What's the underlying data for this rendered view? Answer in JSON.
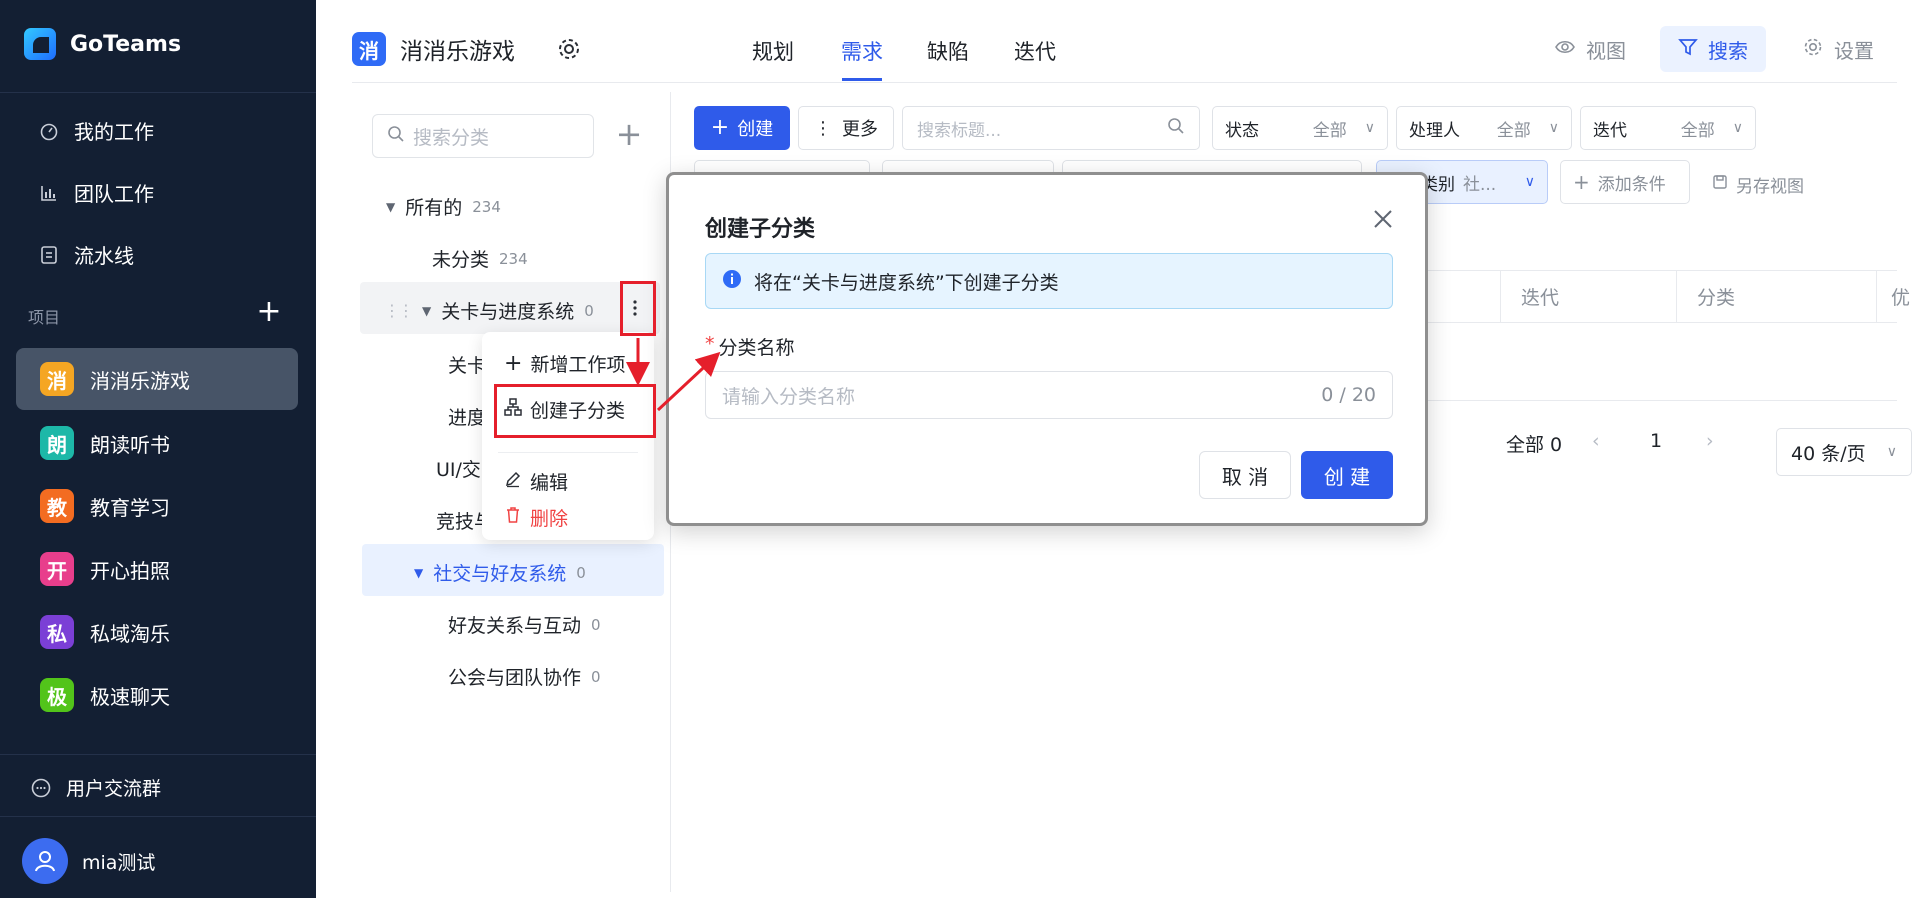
{
  "app": {
    "name": "GoTeams"
  },
  "nav": {
    "items": [
      {
        "label": "我的工作",
        "icon": "dashboard-icon"
      },
      {
        "label": "团队工作",
        "icon": "bar-chart-icon"
      },
      {
        "label": "流水线",
        "icon": "pipeline-icon"
      }
    ],
    "projects_label": "项目",
    "projects": [
      {
        "badge": "消",
        "name": "消消乐游戏",
        "color": "#f5a623",
        "active": true
      },
      {
        "badge": "朗",
        "name": "朗读听书",
        "color": "#1db8a8"
      },
      {
        "badge": "教",
        "name": "教育学习",
        "color": "#f36c21"
      },
      {
        "badge": "开",
        "name": "开心拍照",
        "color": "#e83e8c"
      },
      {
        "badge": "私",
        "name": "私域淘乐",
        "color": "#7b3fd6"
      },
      {
        "badge": "极",
        "name": "极速聊天",
        "color": "#52c41a"
      }
    ],
    "community": "用户交流群",
    "user": "mia测试"
  },
  "header": {
    "project_badge": "消",
    "project_title": "消消乐游戏",
    "tabs": [
      "规划",
      "需求",
      "缺陷",
      "迭代"
    ],
    "active_tab": "需求",
    "view_label": "视图",
    "search_label": "搜索",
    "settings_label": "设置"
  },
  "tree": {
    "search_placeholder": "搜索分类",
    "nodes": [
      {
        "label": "所有的",
        "count": "234"
      },
      {
        "label": "未分类",
        "count": "234"
      },
      {
        "label": "关卡与进度系统",
        "count": "0"
      },
      {
        "label": "关卡"
      },
      {
        "label": "进度"
      },
      {
        "label": "UI/交"
      },
      {
        "label": "竞技与"
      },
      {
        "label": "社交与好友系统",
        "count": "0"
      },
      {
        "label": "好友关系与互动",
        "count": "0"
      },
      {
        "label": "公会与团队协作",
        "count": "0"
      }
    ]
  },
  "context_menu": {
    "add_work_item": "新增工作项",
    "create_child": "创建子分类",
    "edit": "编辑",
    "delete": "删除"
  },
  "toolbar": {
    "create": "创建",
    "more": "更多",
    "search_placeholder": "搜索标题...",
    "filters": [
      {
        "label": "状态",
        "value": "全部"
      },
      {
        "label": "处理人",
        "value": "全部"
      },
      {
        "label": "迭代",
        "value": "全部"
      }
    ],
    "category_filter_label": "类别",
    "category_filter_value": "社...",
    "add_condition": "添加条件",
    "save_view": "另存视图"
  },
  "table": {
    "columns": [
      "迭代",
      "分类",
      "优"
    ]
  },
  "pagination": {
    "total": "全部 0",
    "page": "1",
    "page_size": "40 条/页"
  },
  "modal": {
    "title": "创建子分类",
    "info": "将在“关卡与进度系统”下创建子分类",
    "field_label": "分类名称",
    "field_placeholder": "请输入分类名称",
    "counter": "0 / 20",
    "cancel": "取 消",
    "confirm": "创 建"
  },
  "colors": {
    "sidebar_bg": "#131f33",
    "primary": "#2f5bea",
    "annotation_red": "#e51f2b"
  }
}
